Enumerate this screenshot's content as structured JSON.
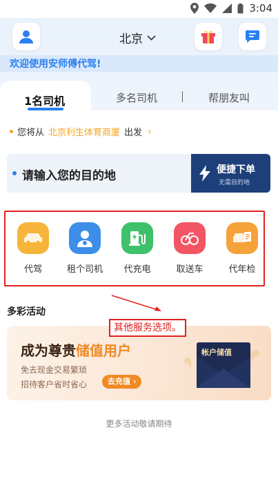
{
  "status_bar": {
    "time": "3:04"
  },
  "header": {
    "city": "北京"
  },
  "welcome": {
    "text": "欢迎使用安师傅代驾!"
  },
  "tabs": [
    {
      "label": "1名司机",
      "active": true
    },
    {
      "label": "多名司机",
      "active": false
    },
    {
      "label": "帮朋友叫",
      "active": false
    }
  ],
  "departure": {
    "prefix": "您将从",
    "place": "北京利生体育商厦",
    "suffix": "出发"
  },
  "destination": {
    "placeholder": "请输入您的目的地"
  },
  "quick_order": {
    "title": "便捷下单",
    "subtitle": "无需目的地"
  },
  "services": [
    {
      "label": "代驾",
      "color": "#f7b43a"
    },
    {
      "label": "租个司机",
      "color": "#3c8ee8"
    },
    {
      "label": "代充电",
      "color": "#3fc06a"
    },
    {
      "label": "取送车",
      "color": "#f25563"
    },
    {
      "label": "代年检",
      "color": "#f5a23a"
    }
  ],
  "activities": {
    "title": "多彩活动"
  },
  "annotation": {
    "text": "其他服务选项。"
  },
  "promo": {
    "title_part1": "成为尊贵",
    "title_part2": "储值用户",
    "line1": "免去现金交易繁琐",
    "line2": "招待客户省时省心",
    "button": "去充值 ›",
    "wallet_label": "帐户储值"
  },
  "footer": {
    "more_text": "更多活动敬请期待"
  },
  "colors": {
    "primary": "#2b7ff0",
    "accent": "#f5a623",
    "quick_order_bg": "#1d3f7a",
    "annotation": "#e02020"
  }
}
